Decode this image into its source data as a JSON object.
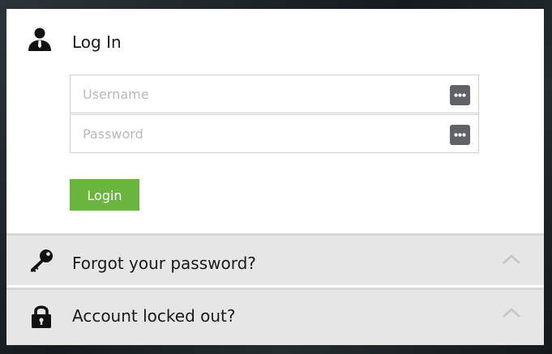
{
  "login": {
    "title": "Log In",
    "icon": "user-icon",
    "username": {
      "placeholder": "Username",
      "value": ""
    },
    "password": {
      "placeholder": "Password",
      "value": ""
    },
    "password_manager_icon": "password-manager-icon",
    "button_label": "Login"
  },
  "accordion": [
    {
      "label": "Forgot your password?",
      "icon": "key-icon",
      "state": "collapsed"
    },
    {
      "label": "Account locked out?",
      "icon": "lock-icon",
      "state": "collapsed"
    }
  ],
  "colors": {
    "accent": "#6ab53e",
    "panel": "#ffffff",
    "accordion_bg": "#e6e6e6",
    "background": "#1d2326"
  }
}
